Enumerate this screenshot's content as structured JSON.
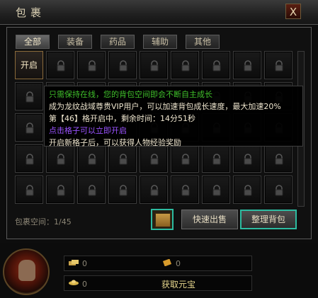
{
  "window": {
    "title": "包裹",
    "close_glyph": "X"
  },
  "tabs": [
    {
      "label": "全部",
      "active": true
    },
    {
      "label": "装备",
      "active": false
    },
    {
      "label": "药品",
      "active": false
    },
    {
      "label": "辅助",
      "active": false
    },
    {
      "label": "其他",
      "active": false
    }
  ],
  "grid": {
    "open_slot_label": "开启"
  },
  "tooltip": {
    "lines": [
      {
        "text": "只需保持在线，您的背包空间即会不断自主成长",
        "color": "#3fbf2a"
      },
      {
        "text": "成为龙纹战域尊贵VIP用户，可以加速背包成长速度，最大加速20%",
        "color": "#efe6cf"
      },
      {
        "text": "第【46】格开启中，剩余时间：14分51秒",
        "color": "#efe6cf"
      },
      {
        "text": "点击格子可以立即开启",
        "color": "#9a52ff"
      },
      {
        "text": "开启新格子后，可以获得人物经验奖励",
        "color": "#efe6cf"
      }
    ]
  },
  "bag_space": {
    "label": "包裹空间：1/45"
  },
  "buttons": {
    "quick_sell": "快速出售",
    "sort": "整理背包"
  },
  "currency": {
    "gold": "0",
    "bound_gold": "0",
    "yuanbao": "0",
    "get_yuanbao": "获取元宝"
  },
  "colors": {
    "accent_teal": "#2dbba0",
    "gold_text": "#e6d68c"
  }
}
